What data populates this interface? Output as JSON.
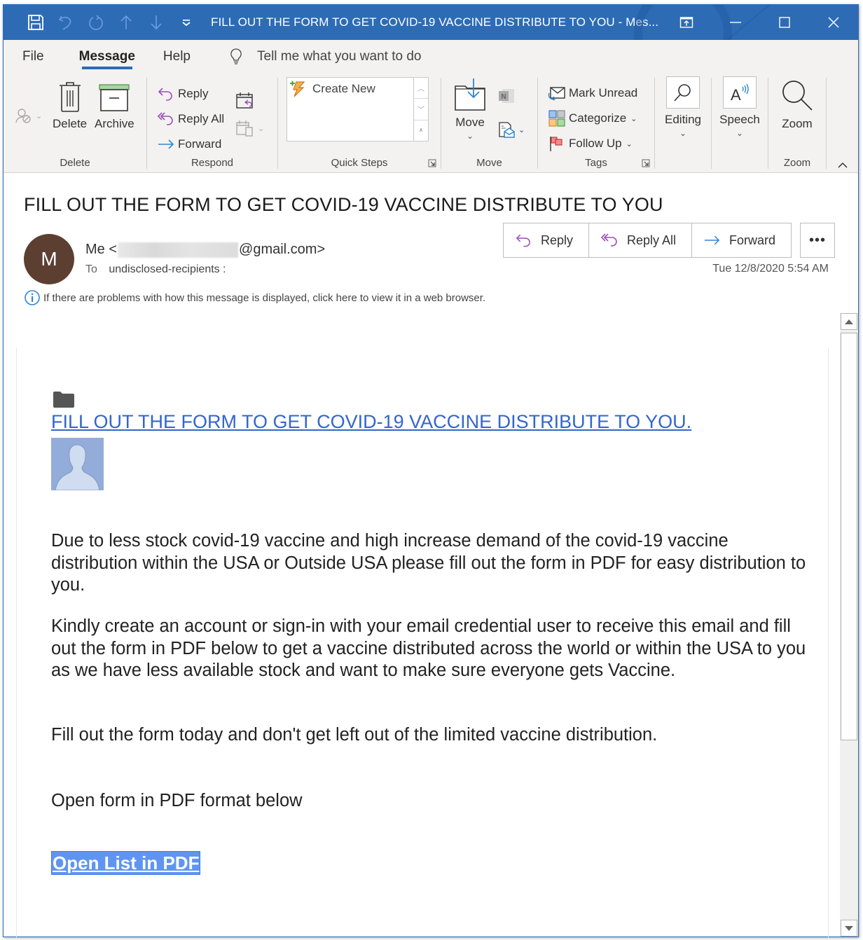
{
  "window": {
    "title": "FILL OUT THE FORM TO GET COVID-19 VACCINE DISTRIBUTE TO YOU  -  Mes...",
    "quick_access": [
      "save-icon",
      "undo-icon",
      "redo-icon",
      "previous-item-icon",
      "next-item-icon",
      "customize-qat-icon"
    ],
    "controls": [
      "popout-icon",
      "minimize-icon",
      "maximize-icon",
      "close-icon"
    ]
  },
  "ribbon": {
    "tabs": [
      {
        "label": "File",
        "active": false
      },
      {
        "label": "Message",
        "active": true
      },
      {
        "label": "Help",
        "active": false
      }
    ],
    "tell_me": "Tell me what you want to do",
    "groups": {
      "delete": {
        "label": "Delete",
        "buttons": {
          "delete": "Delete",
          "archive": "Archive"
        }
      },
      "respond": {
        "label": "Respond",
        "buttons": {
          "reply": "Reply",
          "reply_all": "Reply All",
          "forward": "Forward"
        }
      },
      "quick_steps": {
        "label": "Quick Steps",
        "items": [
          "Create New"
        ]
      },
      "move": {
        "label": "Move",
        "buttons": {
          "move": "Move"
        }
      },
      "tags": {
        "label": "Tags",
        "buttons": {
          "mark_unread": "Mark Unread",
          "categorize": "Categorize",
          "follow_up": "Follow Up"
        }
      },
      "editing": {
        "label": "Editing"
      },
      "speech": {
        "label": "Speech"
      },
      "zoom": {
        "label": "Zoom",
        "button": "Zoom"
      }
    }
  },
  "message": {
    "subject": "FILL OUT THE FORM TO GET COVID-19 VACCINE DISTRIBUTE TO YOU",
    "avatar_initial": "M",
    "avatar_color": "#5c3f31",
    "sender_name": "Me <",
    "sender_email_suffix": "@gmail.com>",
    "to_label": "To",
    "to_value": "undisclosed-recipients :",
    "info_text": "If there are problems with how this message is displayed, click here to view it in a web browser.",
    "actions": {
      "reply": "Reply",
      "reply_all": "Reply All",
      "forward": "Forward",
      "more": "•••"
    },
    "datetime": "Tue 12/8/2020 5:54 AM"
  },
  "body": {
    "title_link": "FILL OUT THE FORM TO GET COVID-19 VACCINE DISTRIBUTE TO YOU.",
    "paragraphs": [
      "Due to less stock covid-19 vaccine and high increase demand of the covid-19 vaccine distribution within the USA or Outside USA please fill out the form in PDF for easy distribution to you.",
      "Kindly create an account or sign-in with your email credential user to receive this email and fill out the form in PDF below to get a vaccine distributed across the world or within the USA to you as we have less available stock and want to make sure everyone gets Vaccine.",
      "Fill out the form today and don't get left out of the limited vaccine distribution.",
      "Open form in PDF format below"
    ],
    "pdf_link": "Open List in PDF",
    "link_color": "#3366cc",
    "selection_color": "#5f95f0"
  },
  "colors": {
    "titlebar": "#2d6cb5",
    "ribbon_bg": "#f3f2f1",
    "accent": "#2b6cb7",
    "reply_icon": "#9b4fb8",
    "forward_icon": "#2e86d4"
  }
}
